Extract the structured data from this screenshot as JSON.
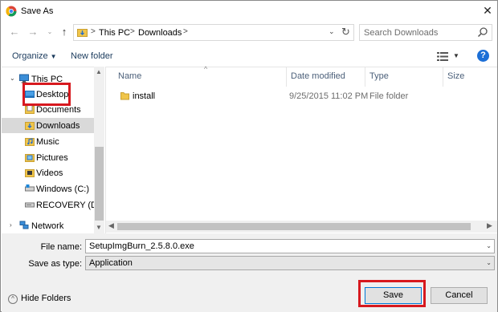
{
  "window": {
    "title": "Save As"
  },
  "address": {
    "crumbs": [
      "This PC",
      "Downloads"
    ],
    "search_placeholder": "Search Downloads"
  },
  "toolbar": {
    "organize_label": "Organize",
    "new_folder_label": "New folder"
  },
  "nav": {
    "items": [
      {
        "label": "This PC",
        "icon": "pc-icon"
      },
      {
        "label": "Desktop",
        "icon": "desktop-folder-icon"
      },
      {
        "label": "Documents",
        "icon": "documents-folder-icon"
      },
      {
        "label": "Downloads",
        "icon": "downloads-folder-icon",
        "selected": true
      },
      {
        "label": "Music",
        "icon": "music-folder-icon"
      },
      {
        "label": "Pictures",
        "icon": "pictures-folder-icon"
      },
      {
        "label": "Videos",
        "icon": "videos-folder-icon"
      },
      {
        "label": "Windows (C:)",
        "icon": "drive-icon"
      },
      {
        "label": "RECOVERY (D:)",
        "icon": "drive-icon"
      },
      {
        "label": "Network",
        "icon": "network-icon"
      }
    ]
  },
  "table": {
    "columns": [
      "Name",
      "Date modified",
      "Type",
      "Size"
    ],
    "rows": [
      {
        "name": "install",
        "date": "9/25/2015 11:02 PM",
        "type": "File folder",
        "size": ""
      }
    ]
  },
  "form": {
    "file_name_label": "File name:",
    "file_name_value": "SetupImgBurn_2.5.8.0.exe",
    "save_type_label": "Save as type:",
    "save_type_value": "Application"
  },
  "footer": {
    "hide_folders_label": "Hide Folders",
    "save_label": "Save",
    "cancel_label": "Cancel"
  },
  "colors": {
    "highlight": "#d7191f",
    "accent": "#0078d7"
  }
}
